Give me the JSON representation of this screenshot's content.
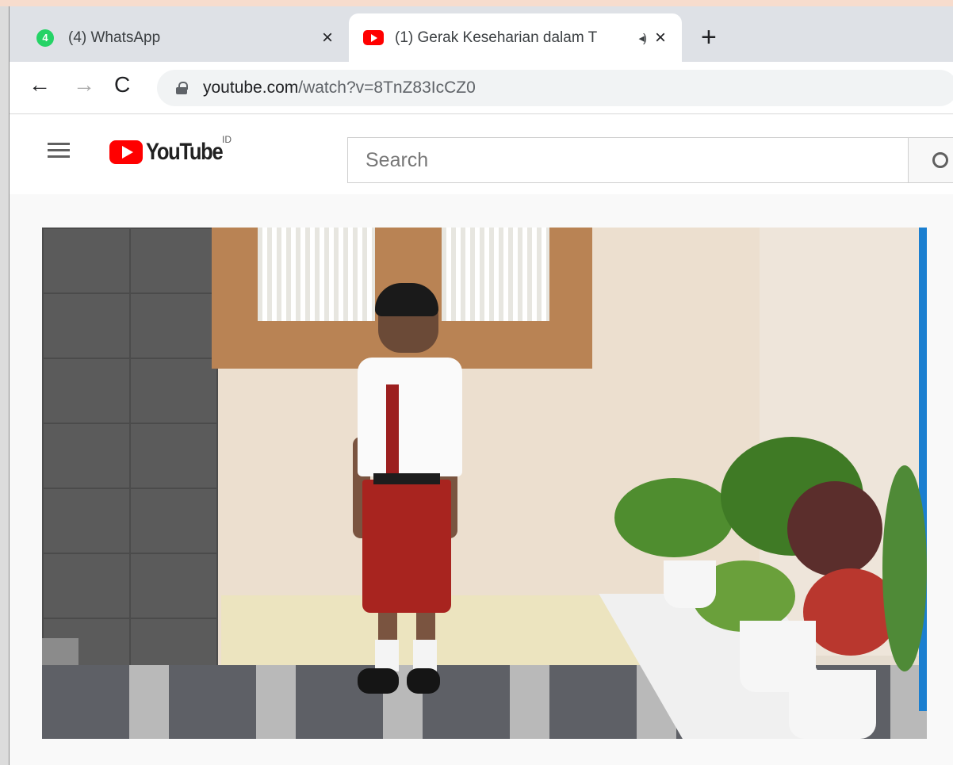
{
  "tabs": [
    {
      "title": "(4) WhatsApp",
      "icon": "whatsapp-icon",
      "badge": "4",
      "active": false
    },
    {
      "title": "(1) Gerak Keseharian dalam T",
      "icon": "youtube-favicon-icon",
      "active": true,
      "playing_audio": true
    }
  ],
  "icons": {
    "close": "×",
    "new_tab": "+",
    "back": "←",
    "forward": "→",
    "reload": "C",
    "audio": "◂)"
  },
  "address_bar": {
    "domain": "youtube.com",
    "path": "/watch?v=8TnZ83IcCZ0"
  },
  "youtube": {
    "wordmark": "YouTube",
    "region": "ID",
    "search_placeholder": "Search"
  },
  "colors": {
    "youtube_red": "#ff0000",
    "whatsapp_green": "#25d366",
    "tab_strip": "#dee1e6",
    "page_bg": "#f9f9f9"
  }
}
